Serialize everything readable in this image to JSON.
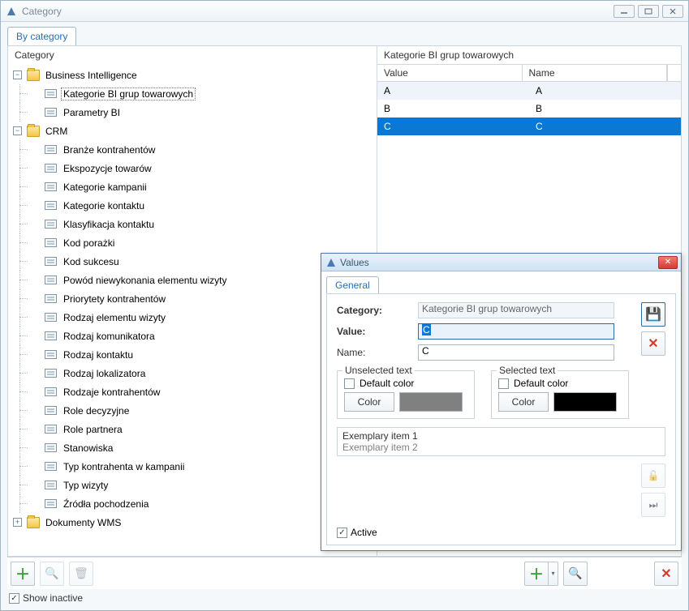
{
  "window": {
    "title": "Category"
  },
  "tabs": {
    "by_category": "By category"
  },
  "left": {
    "header": "Category",
    "tree": [
      {
        "label": "Business Intelligence",
        "type": "folder",
        "expanded": true,
        "children": [
          {
            "label": "Kategorie BI grup towarowych",
            "type": "leaf",
            "selected": true
          },
          {
            "label": "Parametry BI",
            "type": "leaf"
          }
        ]
      },
      {
        "label": "CRM",
        "type": "folder",
        "expanded": true,
        "children": [
          {
            "label": "Branże kontrahentów",
            "type": "leaf"
          },
          {
            "label": "Ekspozycje towarów",
            "type": "leaf"
          },
          {
            "label": "Kategorie kampanii",
            "type": "leaf"
          },
          {
            "label": "Kategorie kontaktu",
            "type": "leaf"
          },
          {
            "label": "Klasyfikacja kontaktu",
            "type": "leaf"
          },
          {
            "label": "Kod porażki",
            "type": "leaf"
          },
          {
            "label": "Kod sukcesu",
            "type": "leaf"
          },
          {
            "label": "Powód niewykonania elementu wizyty",
            "type": "leaf"
          },
          {
            "label": "Priorytety kontrahentów",
            "type": "leaf"
          },
          {
            "label": "Rodzaj elementu wizyty",
            "type": "leaf"
          },
          {
            "label": "Rodzaj komunikatora",
            "type": "leaf"
          },
          {
            "label": "Rodzaj kontaktu",
            "type": "leaf"
          },
          {
            "label": "Rodzaj lokalizatora",
            "type": "leaf"
          },
          {
            "label": "Rodzaje kontrahentów",
            "type": "leaf"
          },
          {
            "label": "Role decyzyjne",
            "type": "leaf"
          },
          {
            "label": "Role partnera",
            "type": "leaf"
          },
          {
            "label": "Stanowiska",
            "type": "leaf"
          },
          {
            "label": "Typ kontrahenta w kampanii",
            "type": "leaf"
          },
          {
            "label": "Typ wizyty",
            "type": "leaf"
          },
          {
            "label": "Źródła pochodzenia",
            "type": "leaf"
          }
        ]
      },
      {
        "label": "Dokumenty WMS",
        "type": "folder",
        "expanded": false
      }
    ]
  },
  "right": {
    "title": "Kategorie BI grup towarowych",
    "columns": {
      "value": "Value",
      "name": "Name"
    },
    "rows": [
      {
        "value": "A",
        "name": "A"
      },
      {
        "value": "B",
        "name": "B"
      },
      {
        "value": "C",
        "name": "C",
        "selected": true
      }
    ]
  },
  "bottom": {
    "show_inactive": "Show inactive",
    "show_inactive_checked": true
  },
  "dialog": {
    "title": "Values",
    "tab_general": "General",
    "fields": {
      "category_label": "Category:",
      "category_value": "Kategorie BI grup towarowych",
      "value_label": "Value:",
      "value_value": "C",
      "name_label": "Name:",
      "name_value": "C"
    },
    "unselected": {
      "legend": "Unselected text",
      "default_label": "Default color",
      "default_checked": false,
      "color_btn": "Color",
      "swatch": "#808080"
    },
    "selected_text": {
      "legend": "Selected text",
      "default_label": "Default color",
      "default_checked": false,
      "color_btn": "Color",
      "swatch": "#000000"
    },
    "exemplary1": "Exemplary item 1",
    "exemplary2": "Exemplary item 2",
    "active_label": "Active",
    "active_checked": true
  }
}
